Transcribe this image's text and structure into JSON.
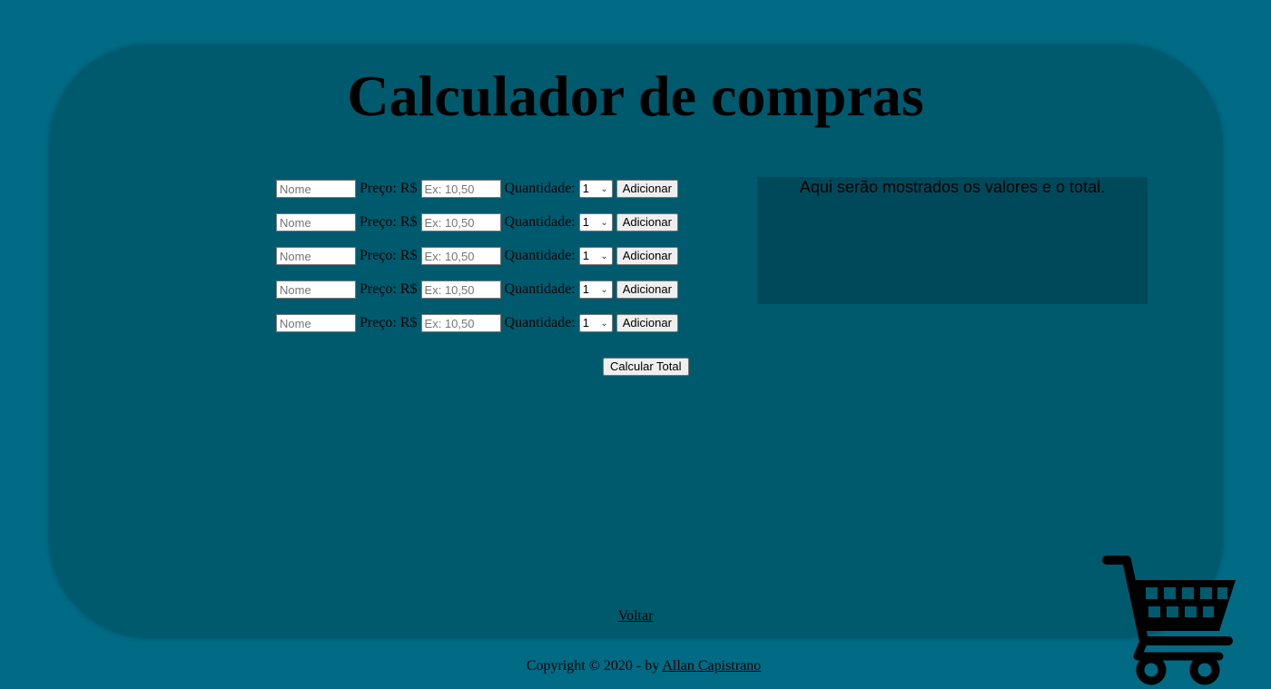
{
  "title": "Calculador de compras",
  "form": {
    "name_placeholder": "Nome",
    "price_label": "Preço: R$",
    "price_placeholder": "Ex: 10,50",
    "qty_label": "Quantidade:",
    "qty_value": "1",
    "add_label": "Adicionar"
  },
  "rows": [
    1,
    2,
    3,
    4,
    5
  ],
  "calc_label": "Calcular Total",
  "result_text": "Aqui serão mostrados os valores e o total.",
  "back_label": "Voltar",
  "footer": {
    "text": "Copyright © 2020 - by ",
    "author": "Allan Capistrano"
  },
  "icons": {
    "cart": "shopping-cart-icon",
    "chevron": "chevron-down-icon"
  },
  "colors": {
    "background": "#016a84",
    "card": "#005a6e",
    "result_box": "#00495a"
  }
}
